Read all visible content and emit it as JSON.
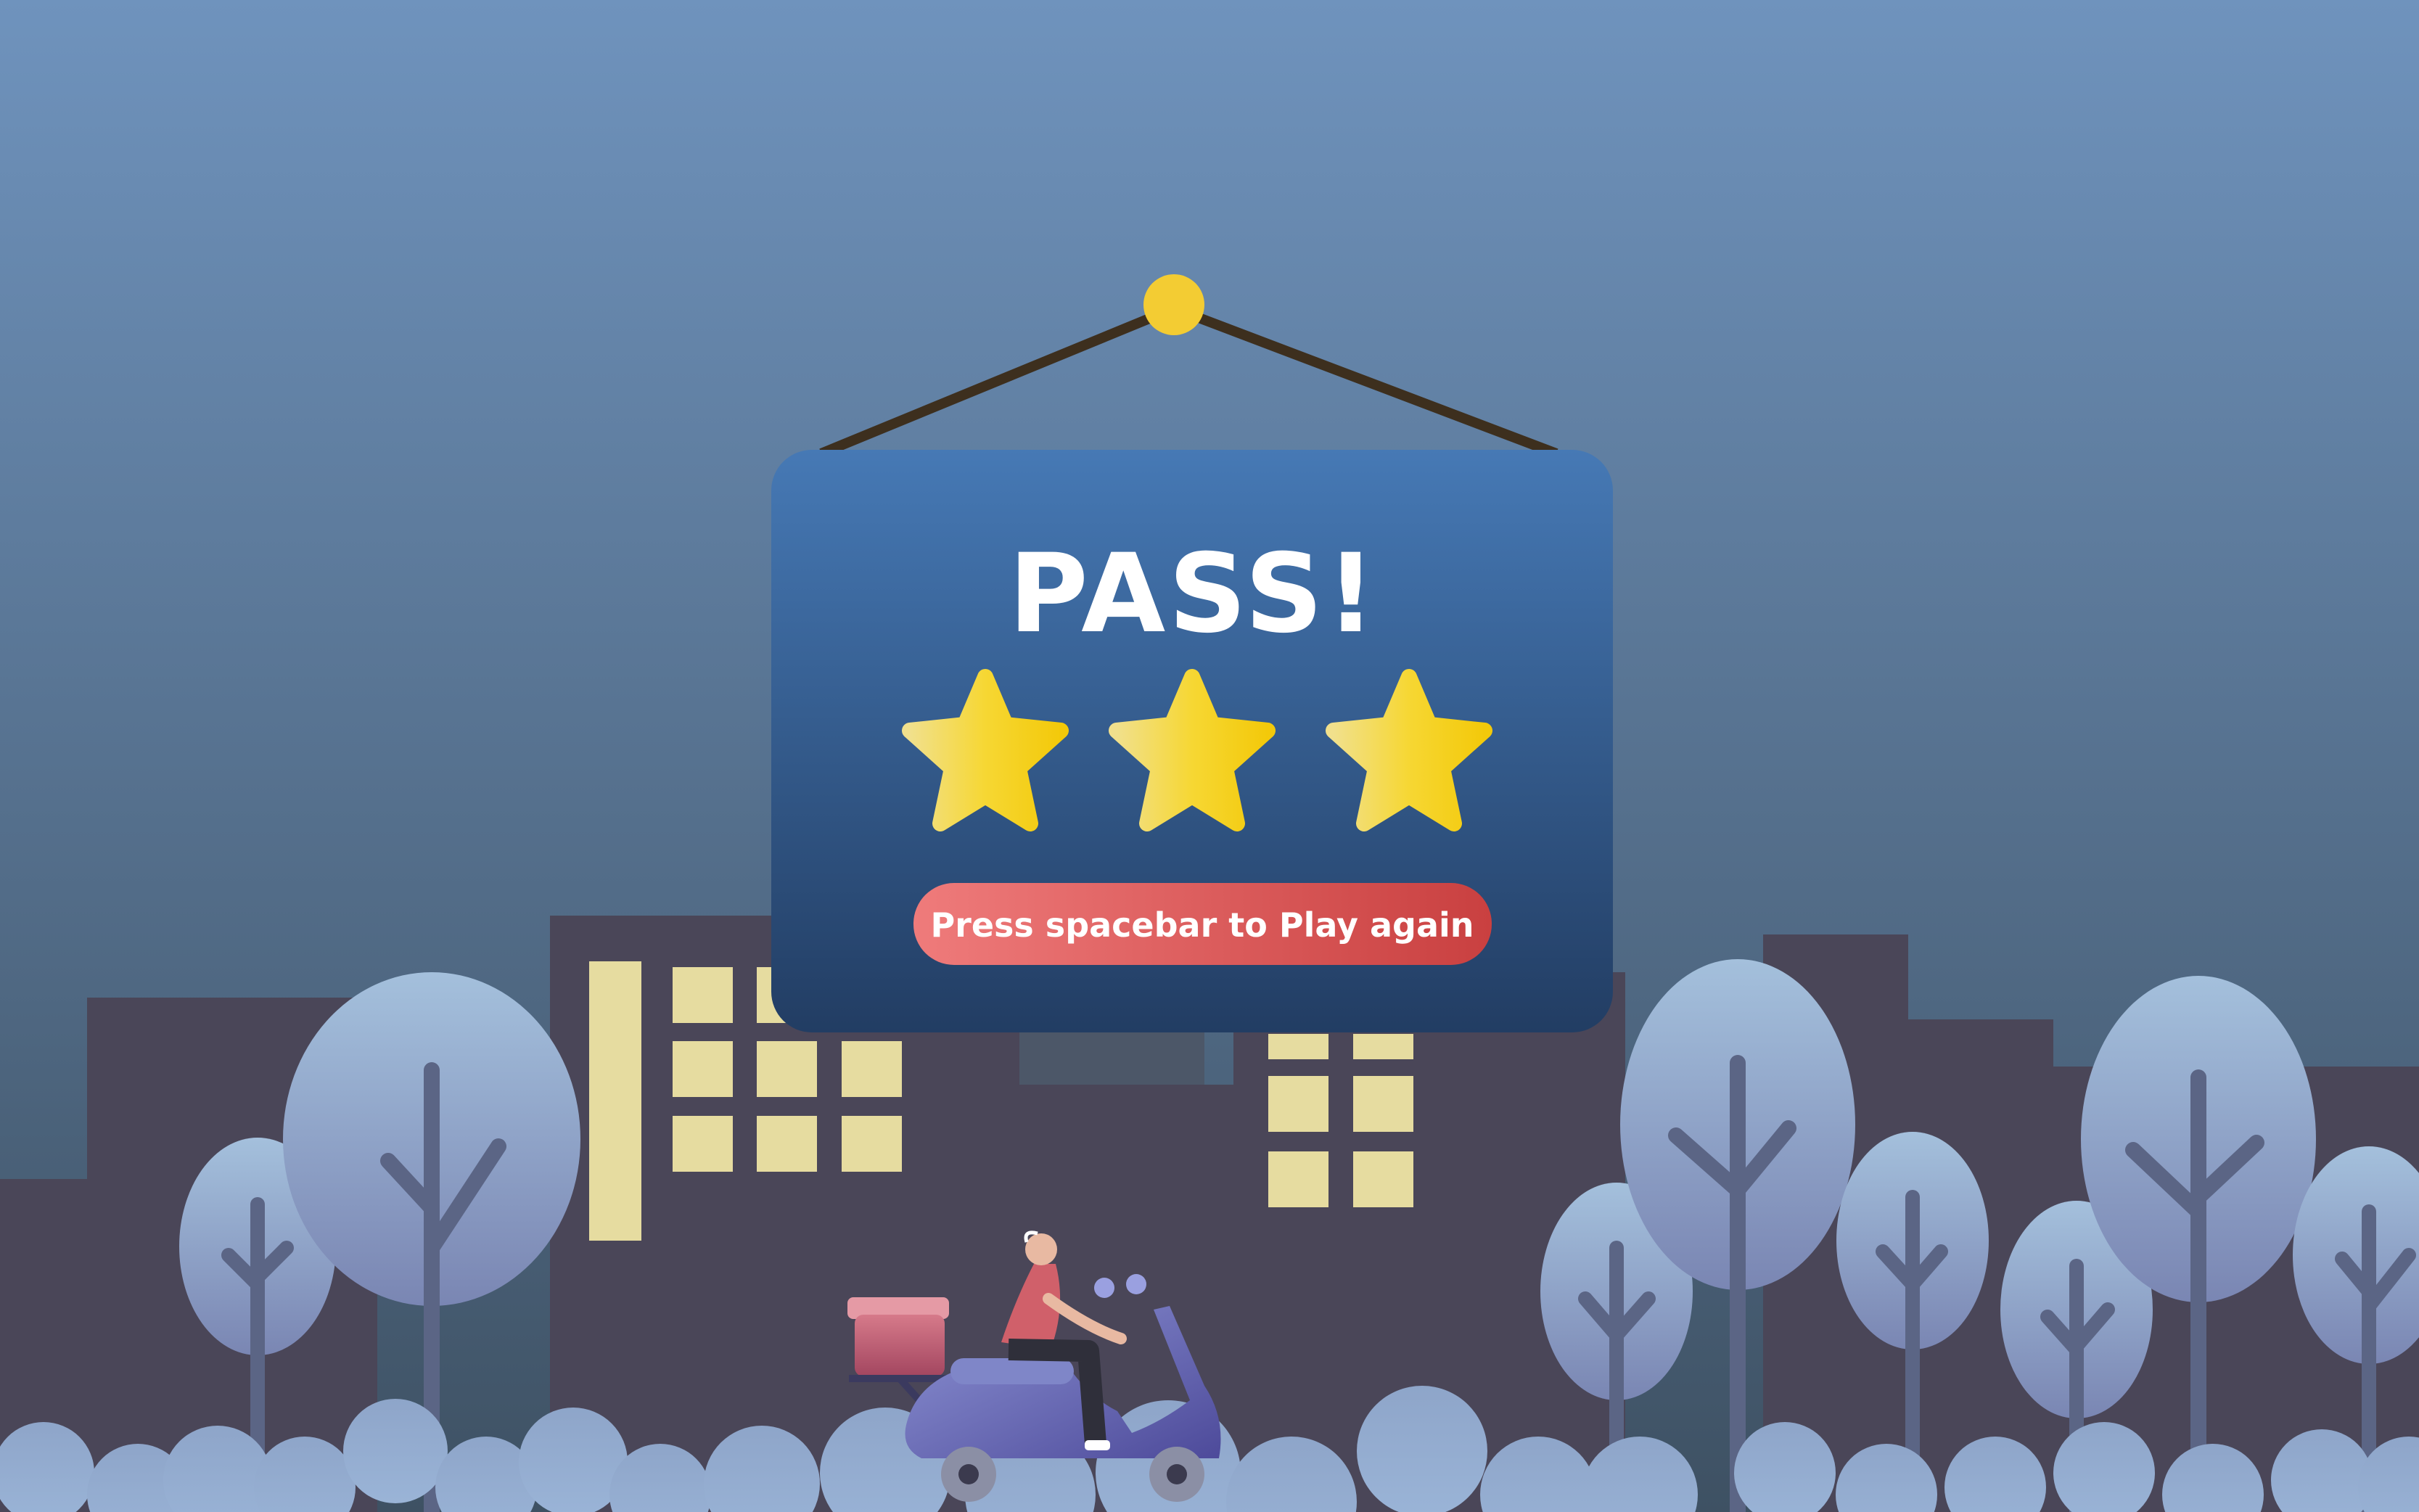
{
  "result": {
    "title": "PASS!",
    "stars_earned": 3,
    "stars_total": 3,
    "prompt": "Press spacebar to Play again"
  },
  "colors": {
    "sky_top": "#6f93bd",
    "sky_bottom": "#3e5163",
    "sign_top": "#4679b5",
    "sign_bottom": "#223d63",
    "star": "#f5cf1e",
    "button_left": "#ef7b7b",
    "button_right": "#c94040",
    "building": "#4a4658",
    "window": "#e6dca0",
    "tree": "#9eb7d6",
    "rope": "#3d2f1e",
    "pin": "#f3cc33"
  },
  "icons": [
    "star-icon",
    "delivery-scooter",
    "trees",
    "buildings"
  ]
}
